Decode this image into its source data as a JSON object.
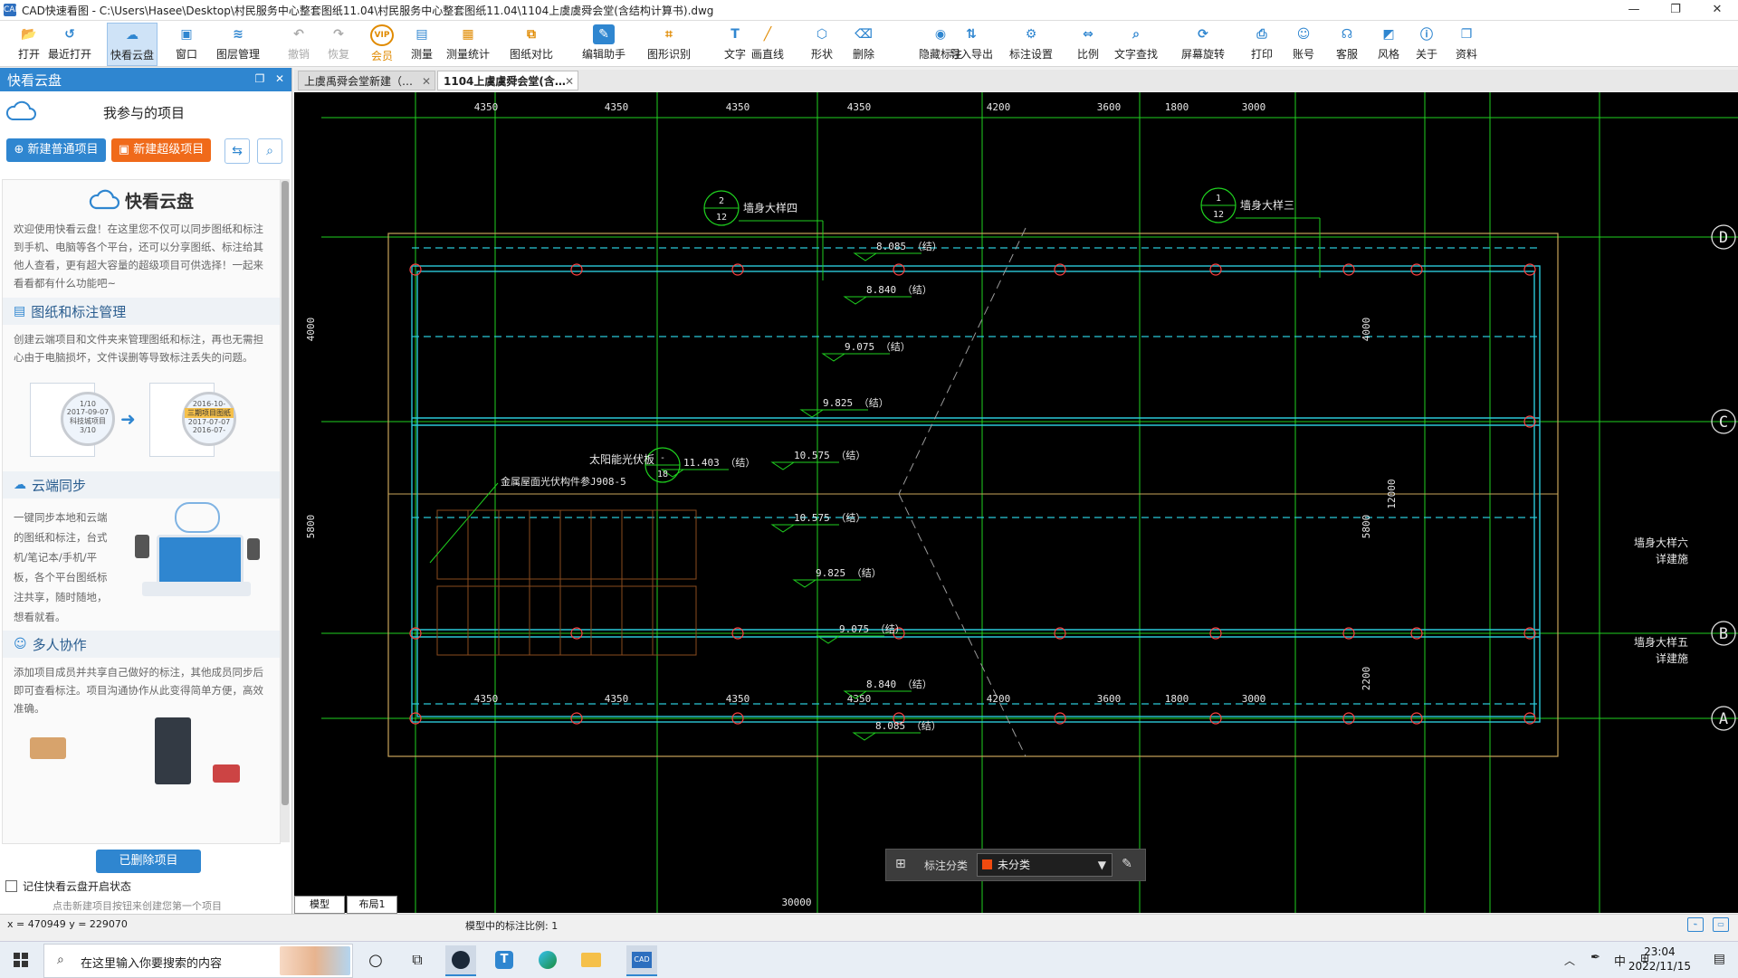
{
  "window": {
    "app_icon": "CAD",
    "title": "CAD快速看图 - C:\\Users\\Hasee\\Desktop\\村民服务中心整套图纸11.04\\村民服务中心整套图纸11.04\\1104上虞虞舜会堂(含结构计算书).dwg",
    "controls": {
      "minimize": "—",
      "maximize": "❐",
      "close": "✕"
    }
  },
  "toolbar": [
    {
      "id": "open",
      "label": "打开",
      "icon": "folder-open-icon",
      "glyph": "📂",
      "color": "#2f86d0"
    },
    {
      "id": "recent",
      "label": "最近打开",
      "icon": "history-icon",
      "glyph": "↺",
      "color": "#2f86d0"
    },
    {
      "id": "cloud",
      "label": "快看云盘",
      "icon": "cloud-icon",
      "glyph": "☁",
      "color": "#2f86d0",
      "active": true
    },
    {
      "id": "window",
      "label": "窗口",
      "icon": "window-icon",
      "glyph": "▣",
      "color": "#2f86d0"
    },
    {
      "id": "layers",
      "label": "图层管理",
      "icon": "layers-icon",
      "glyph": "≋",
      "color": "#2f86d0"
    },
    {
      "id": "undo",
      "label": "撤销",
      "icon": "undo-icon",
      "glyph": "↶",
      "color": "#aaa",
      "disabled": true
    },
    {
      "id": "redo",
      "label": "恢复",
      "icon": "redo-icon",
      "glyph": "↷",
      "color": "#aaa",
      "disabled": true
    },
    {
      "id": "vip",
      "label": "会员",
      "icon": "vip-icon",
      "glyph": "VIP",
      "color": "#e08a00",
      "vip": true
    },
    {
      "id": "measure",
      "label": "测量",
      "icon": "ruler-icon",
      "glyph": "▤",
      "color": "#2f86d0"
    },
    {
      "id": "measure_stats",
      "label": "测量统计",
      "icon": "stats-icon",
      "glyph": "▦",
      "color": "#e08a00"
    },
    {
      "id": "compare",
      "label": "图纸对比",
      "icon": "compare-icon",
      "glyph": "⧉",
      "color": "#e08a00"
    },
    {
      "id": "edit_assist",
      "label": "编辑助手",
      "icon": "edit-assistant-icon",
      "glyph": "✎",
      "color": "#fff",
      "bg": "#2f86d0"
    },
    {
      "id": "recognize",
      "label": "图形识别",
      "icon": "shape-recognize-icon",
      "glyph": "⌗",
      "color": "#e08a00"
    },
    {
      "id": "text",
      "label": "文字",
      "icon": "text-icon",
      "glyph": "T",
      "color": "#2f86d0"
    },
    {
      "id": "line",
      "label": "画直线",
      "icon": "line-icon",
      "glyph": "╱",
      "color": "#e08a00"
    },
    {
      "id": "shape",
      "label": "形状",
      "icon": "shape-icon",
      "glyph": "⬡",
      "color": "#2f86d0"
    },
    {
      "id": "erase",
      "label": "删除",
      "icon": "eraser-icon",
      "glyph": "⌫",
      "color": "#2f86d0"
    },
    {
      "id": "hide_markup",
      "label": "隐藏标注",
      "icon": "eye-hide-icon",
      "glyph": "◉",
      "color": "#2f86d0"
    },
    {
      "id": "import_export",
      "label": "导入导出",
      "icon": "import-export-icon",
      "glyph": "⇅",
      "color": "#2f86d0"
    },
    {
      "id": "markup_settings",
      "label": "标注设置",
      "icon": "markup-settings-icon",
      "glyph": "⚙",
      "color": "#2f86d0"
    },
    {
      "id": "scale",
      "label": "比例",
      "icon": "scale-icon",
      "glyph": "⇔",
      "color": "#2f86d0"
    },
    {
      "id": "text_search",
      "label": "文字查找",
      "icon": "text-search-icon",
      "glyph": "⌕",
      "color": "#2f86d0"
    },
    {
      "id": "rotate",
      "label": "屏幕旋转",
      "icon": "rotate-icon",
      "glyph": "⟳",
      "color": "#2f86d0"
    },
    {
      "id": "print",
      "label": "打印",
      "icon": "print-icon",
      "glyph": "⎙",
      "color": "#2f86d0"
    },
    {
      "id": "account",
      "label": "账号",
      "icon": "user-icon",
      "glyph": "☺",
      "color": "#2f86d0"
    },
    {
      "id": "support",
      "label": "客服",
      "icon": "headset-icon",
      "glyph": "☊",
      "color": "#2f86d0"
    },
    {
      "id": "style",
      "label": "风格",
      "icon": "style-icon",
      "glyph": "◩",
      "color": "#2f86d0"
    },
    {
      "id": "about",
      "label": "关于",
      "icon": "info-icon",
      "glyph": "ⓘ",
      "color": "#2f86d0"
    },
    {
      "id": "resources",
      "label": "资料",
      "icon": "resources-icon",
      "glyph": "❐",
      "color": "#2f86d0"
    }
  ],
  "left_panel": {
    "header": "快看云盘",
    "project_title": "我参与的项目",
    "new_normal": "新建普通项目",
    "new_super": "新建超级项目",
    "intro": {
      "title": "快看云盘",
      "welcome": "欢迎使用快看云盘！在这里您不仅可以同步图纸和标注到手机、电脑等各个平台，还可以分享图纸、标注给其他人查看，更有超大容量的超级项目可供选择！一起来看看都有什么功能吧~",
      "sections": [
        {
          "title": "图纸和标注管理",
          "icon": "document-icon",
          "text": "创建云端项目和文件夹来管理图纸和标注，再也无需担心由于电脑损坏，文件误删等导致标注丢失的问题。"
        },
        {
          "title": "云端同步",
          "icon": "cloud-sync-icon",
          "text": "一键同步本地和云端的图纸和标注，台式机/笔记本/手机/平板，各个平台图纸标注共享，随时随地，想看就看。"
        },
        {
          "title": "多人协作",
          "icon": "team-icon",
          "text": "添加项目成员并共享自己做好的标注，其他成员同步后即可查看标注。项目沟通协作从此变得简单方便，高效准确。"
        }
      ],
      "illus_labels": [
        "1/10",
        "2017-09-07",
        "科技城项目",
        "3/10",
        "2016-07-",
        "2016-10-",
        "三期项目图纸",
        "2017-07-07"
      ]
    },
    "deleted_projects": "已删除项目",
    "remember_label": "记住快看云盘开启状态",
    "hint": "点击新建项目按钮来创建您第一个项目"
  },
  "doc_tabs": [
    {
      "label": "上虞禹舜会堂新建（…",
      "active": false
    },
    {
      "label": "1104上虞虞舜会堂(含…",
      "active": true
    }
  ],
  "drawing": {
    "top_dims": [
      "4350",
      "4350",
      "4350",
      "4350",
      "4200",
      "3600",
      "1800",
      "3000"
    ],
    "bottom_dims": [
      "4350",
      "4350",
      "4350",
      "4350",
      "4200",
      "3600",
      "1800",
      "3000"
    ],
    "bottom_total": "30000",
    "left_dims": [
      "4000",
      "5800"
    ],
    "right_dims": [
      "4000",
      "5800",
      "2200"
    ],
    "right_total": "12000",
    "axis_labels": [
      "D",
      "C",
      "B",
      "A"
    ],
    "callouts": [
      {
        "num": "2",
        "sub": "12",
        "text": "墙身大样四"
      },
      {
        "num": "1",
        "sub": "12",
        "text": "墙身大样三"
      },
      {
        "num": "-",
        "sub": "18",
        "text": "太阳能光伏板"
      }
    ],
    "notes": [
      "金属屋面光伏构件参J908-5",
      "墙身大样六",
      "详建施",
      "墙身大样五",
      "详建施"
    ],
    "elevations": [
      "8.085 （结）",
      "8.840 （结）",
      "9.075 （结）",
      "9.825 （结）",
      "10.575 （结）",
      "11.403 （结）",
      "10.575 （结）",
      "9.825 （结）",
      "9.075 （结）",
      "8.840 （结）",
      "8.085 （结）"
    ]
  },
  "sheet_tabs": [
    "模型",
    "布局1"
  ],
  "markup_panel": {
    "label": "标注分类",
    "value": "未分类",
    "swatch": "#f04a0f"
  },
  "status": {
    "coords": "x = 470949  y = 229070",
    "scale_text": "模型中的标注比例: 1"
  },
  "taskbar": {
    "search_placeholder": "在这里输入你要搜索的内容",
    "time": "23:04",
    "date": "2022/11/15",
    "ime": "中"
  }
}
